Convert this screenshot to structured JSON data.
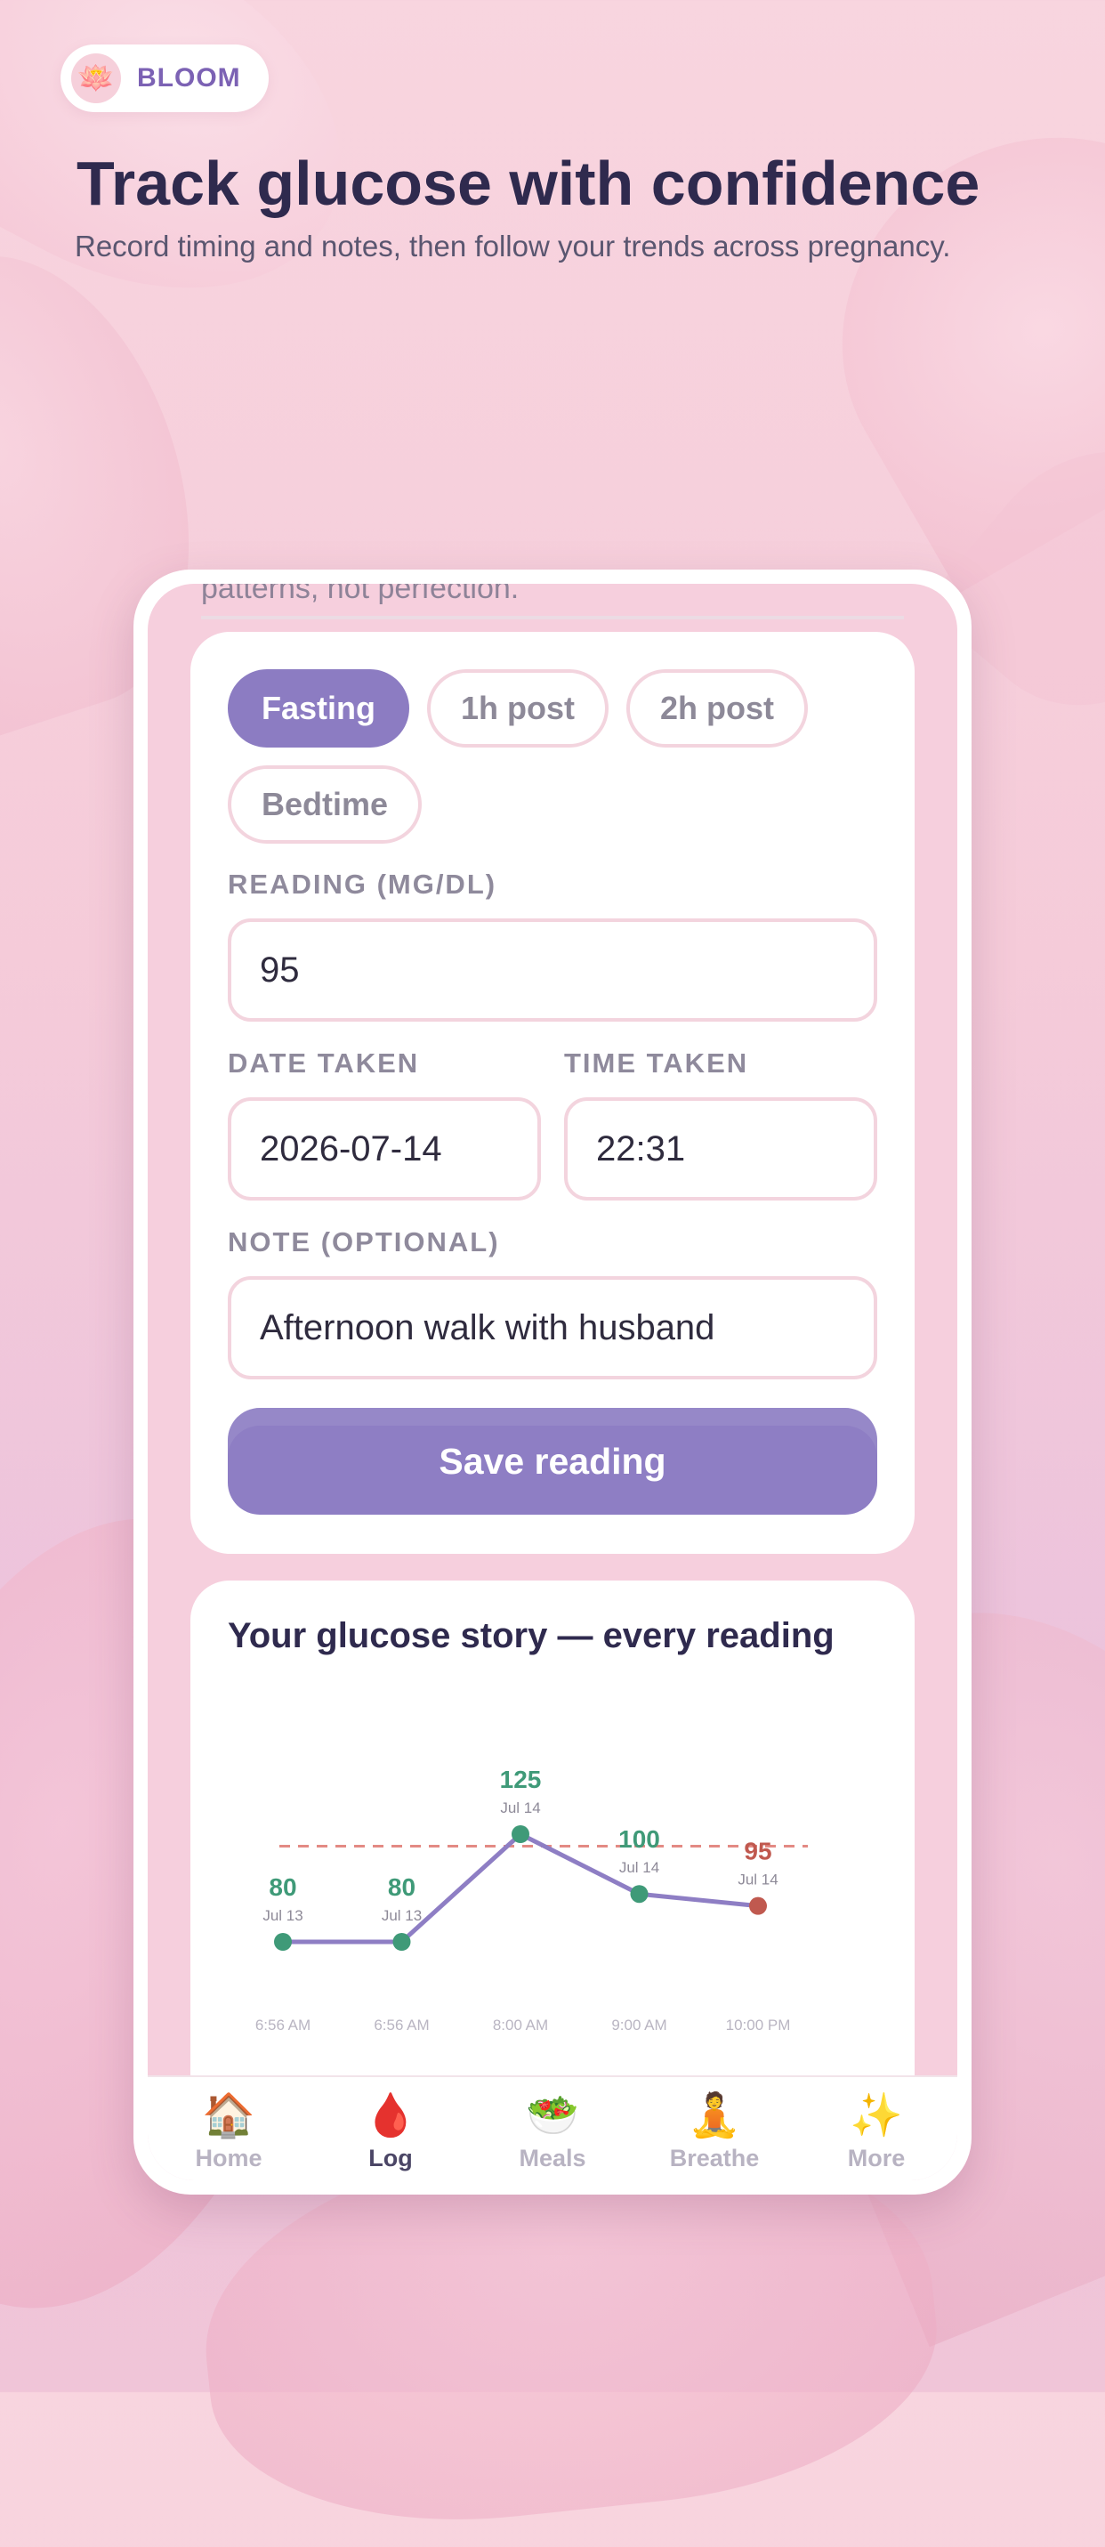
{
  "brand": {
    "name": "BLOOM",
    "logo_icon": "lotus-icon"
  },
  "hero": {
    "title": "Track glucose with confidence",
    "subtitle": "Record timing and notes, then follow your trends across pregnancy."
  },
  "screen": {
    "cutoff_text": "patterns, not perfection."
  },
  "form": {
    "timing_options": [
      {
        "label": "Fasting",
        "active": true
      },
      {
        "label": "1h post",
        "active": false
      },
      {
        "label": "2h post",
        "active": false
      },
      {
        "label": "Bedtime",
        "active": false
      }
    ],
    "reading_label": "READING (MG/DL)",
    "reading_value": "95",
    "date_label": "DATE TAKEN",
    "date_value": "2026-07-14",
    "time_label": "TIME TAKEN",
    "time_value": "22:31",
    "note_label": "NOTE (OPTIONAL)",
    "note_value": "Afternoon walk with husband",
    "save_label": "Save reading"
  },
  "chart": {
    "title": "Your glucose story — every reading"
  },
  "chart_data": {
    "type": "line",
    "title": "Your glucose story — every reading",
    "x": [
      "6:56 AM",
      "6:56 AM",
      "8:00 AM",
      "9:00 AM",
      "10:00 PM"
    ],
    "dates": [
      "Jul 13",
      "Jul 13",
      "Jul 14",
      "Jul 14",
      "Jul 14"
    ],
    "values": [
      80,
      80,
      125,
      100,
      95
    ],
    "value_labels": [
      "80",
      "80",
      "125",
      "100",
      "95"
    ],
    "point_colors": [
      "#3f9a78",
      "#3f9a78",
      "#3f9a78",
      "#3f9a78",
      "#c0594f"
    ],
    "target_line": 120,
    "line_color": "#8e7ec4",
    "target_color": "#e38a84",
    "ylim": [
      60,
      140
    ]
  },
  "tabs": [
    {
      "label": "Home",
      "icon": "🏠",
      "icon_name": "home-icon",
      "active": false
    },
    {
      "label": "Log",
      "icon": "🩸",
      "icon_name": "blood-drop-icon",
      "active": true
    },
    {
      "label": "Meals",
      "icon": "🥗",
      "icon_name": "salad-icon",
      "active": false
    },
    {
      "label": "Breathe",
      "icon": "🧘",
      "icon_name": "meditation-icon",
      "active": false
    },
    {
      "label": "More",
      "icon": "✨",
      "icon_name": "sparkles-icon",
      "active": false
    }
  ]
}
